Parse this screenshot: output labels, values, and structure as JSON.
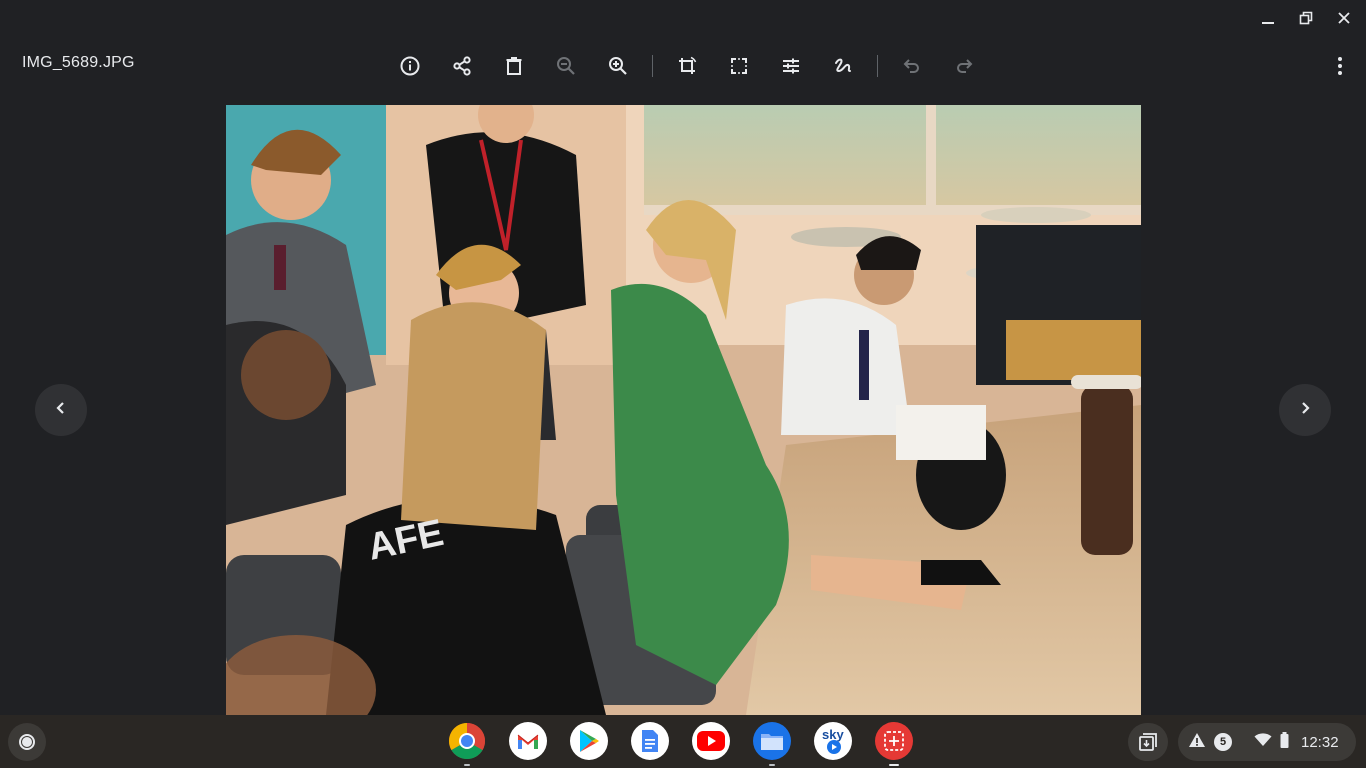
{
  "window": {
    "title": "IMG_5689.JPG",
    "controls": [
      "minimize-icon",
      "restore-icon",
      "close-icon"
    ]
  },
  "toolbar": {
    "buttons": [
      {
        "name": "info-icon",
        "enabled": true
      },
      {
        "name": "share-icon",
        "enabled": true
      },
      {
        "name": "delete-icon",
        "enabled": true
      },
      {
        "name": "zoom-out-icon",
        "enabled": false
      },
      {
        "name": "zoom-in-icon",
        "enabled": true
      },
      {
        "name": "rotate-icon",
        "enabled": true
      },
      {
        "name": "crop-icon",
        "enabled": true
      },
      {
        "name": "adjust-icon",
        "enabled": true
      },
      {
        "name": "annotate-icon",
        "enabled": true
      },
      {
        "name": "undo-icon",
        "enabled": false
      },
      {
        "name": "redo-icon",
        "enabled": false
      }
    ],
    "more": "more-vert-icon"
  },
  "viewer": {
    "prev": "chevron-left-icon",
    "next": "chevron-right-icon"
  },
  "shelf": {
    "apps": [
      "Chrome",
      "Gmail",
      "Play Store",
      "Docs",
      "YouTube",
      "Files",
      "Sky Go",
      "Screencast"
    ],
    "notification_count": "5",
    "time": "12:32"
  },
  "colors": {
    "background": "#202124",
    "shelf": "#2a2724",
    "icon": "#e8eaed",
    "disabled_icon": "#6f7276"
  }
}
